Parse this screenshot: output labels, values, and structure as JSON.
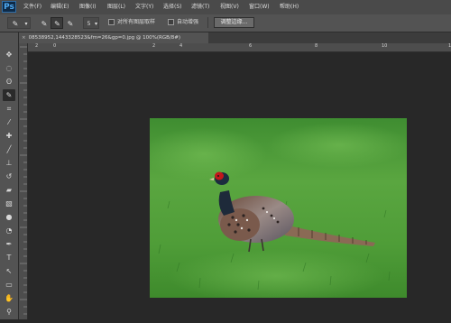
{
  "app": {
    "logo": "Ps"
  },
  "menu": [
    "文件(F)",
    "编辑(E)",
    "图像(I)",
    "图层(L)",
    "文字(Y)",
    "选择(S)",
    "滤镜(T)",
    "视图(V)",
    "窗口(W)",
    "帮助(H)"
  ],
  "options": {
    "tool_icon": "quick-selection-brush-icon",
    "brush_size": "5",
    "sample_all_layers_label": "对所有图层取样",
    "auto_enhance_label": "自动增强",
    "refine_edge_label": "调整边缘..."
  },
  "document": {
    "tab_title": "08538952,1443328523&fm=26&gp=0.jpg @ 100%(RGB/8#)",
    "close_symbol": "×"
  },
  "rulers": {
    "labels": [
      "2",
      "0",
      "2",
      "4",
      "6",
      "8",
      "10",
      "12",
      "14"
    ]
  },
  "toolbar": {
    "tools": [
      {
        "name": "move-icon",
        "glyph": "✥"
      },
      {
        "name": "marquee-icon",
        "glyph": "◌"
      },
      {
        "name": "lasso-icon",
        "glyph": "ʘ"
      },
      {
        "name": "quick-selection-icon",
        "glyph": "✎",
        "active": true
      },
      {
        "name": "crop-icon",
        "glyph": "⌗"
      },
      {
        "name": "eyedropper-icon",
        "glyph": "⁄"
      },
      {
        "name": "healing-brush-icon",
        "glyph": "✚"
      },
      {
        "name": "brush-icon",
        "glyph": "╱"
      },
      {
        "name": "clone-stamp-icon",
        "glyph": "⊥"
      },
      {
        "name": "history-brush-icon",
        "glyph": "↺"
      },
      {
        "name": "eraser-icon",
        "glyph": "▰"
      },
      {
        "name": "gradient-icon",
        "glyph": "▧"
      },
      {
        "name": "blur-icon",
        "glyph": "●"
      },
      {
        "name": "dodge-icon",
        "glyph": "◔"
      },
      {
        "name": "pen-icon",
        "glyph": "✒"
      },
      {
        "name": "type-icon",
        "glyph": "T"
      },
      {
        "name": "path-selection-icon",
        "glyph": "↖"
      },
      {
        "name": "shape-icon",
        "glyph": "▭"
      },
      {
        "name": "hand-icon",
        "glyph": "✋"
      },
      {
        "name": "zoom-icon",
        "glyph": "⚲"
      }
    ]
  }
}
